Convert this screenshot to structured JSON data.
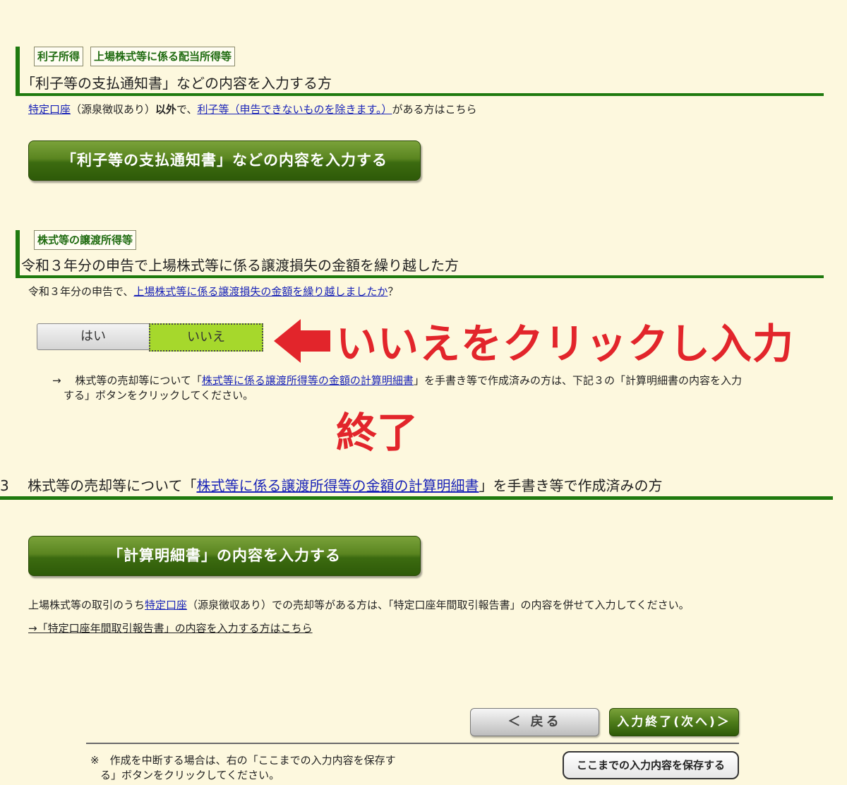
{
  "section1": {
    "tags": [
      "利子所得",
      "上場株式等に係る配当所得等"
    ],
    "title": "「利子等の支払通知書」などの内容を入力する方",
    "desc_link1": "特定口座",
    "desc_text1": "（源泉徴収あり）",
    "desc_bold": "以外",
    "desc_text2": "で、",
    "desc_link2": "利子等（申告できないものを除きます。）",
    "desc_text3": "がある方はこちら",
    "button": "「利子等の支払通知書」などの内容を入力する"
  },
  "section2": {
    "tags": [
      "株式等の譲渡所得等"
    ],
    "title": "令和３年分の申告で上場株式等に係る譲渡損失の金額を繰り越した方",
    "question_prefix": "令和３年分の申告で、",
    "question_link": "上場株式等に係る譲渡損失の金額を繰り越しましたか",
    "question_suffix": "？",
    "yes_label": "はい",
    "no_label": "いいえ",
    "note_arrow": "→",
    "note_text1": "株式等の売却等について「",
    "note_link": "株式等に係る譲渡所得等の金額の計算明細書",
    "note_text2": "」を手書き等で作成済みの方は、下記３の「計算明細書の内容を入力",
    "note_text3": "する」ボタンをクリックしてください。"
  },
  "annotation": {
    "line1": "いいえをクリックし入力",
    "line2": "終了",
    "color": "#e2252b"
  },
  "section3": {
    "number": "3",
    "title_text1": "株式等の売却等について「",
    "title_link": "株式等に係る譲渡所得等の金額の計算明細書",
    "title_text2": "」を手書き等で作成済みの方",
    "button": "「計算明細書」の内容を入力する",
    "info_text1": "上場株式等の取引のうち",
    "info_link": "特定口座",
    "info_text2": "（源泉徴収あり）での売却等がある方は、「特定口座年間取引報告書」の内容を併せて入力してください。",
    "info_link2": "→「特定口座年間取引報告書」の内容を入力する方はこちら"
  },
  "footer": {
    "back_label": "＜ 戻る",
    "next_label": "入力終了(次へ)＞",
    "note_line1": "※　作成を中断する場合は、右の「ここまでの入力内容を保存す",
    "note_line2": "る」ボタンをクリックしてください。",
    "save_label": "ここまでの入力内容を保存する"
  },
  "colors": {
    "background": "#fdf8de",
    "accent_green": "#1f7a0f",
    "link": "#1a24b8",
    "selected_toggle": "#a6d82c"
  }
}
